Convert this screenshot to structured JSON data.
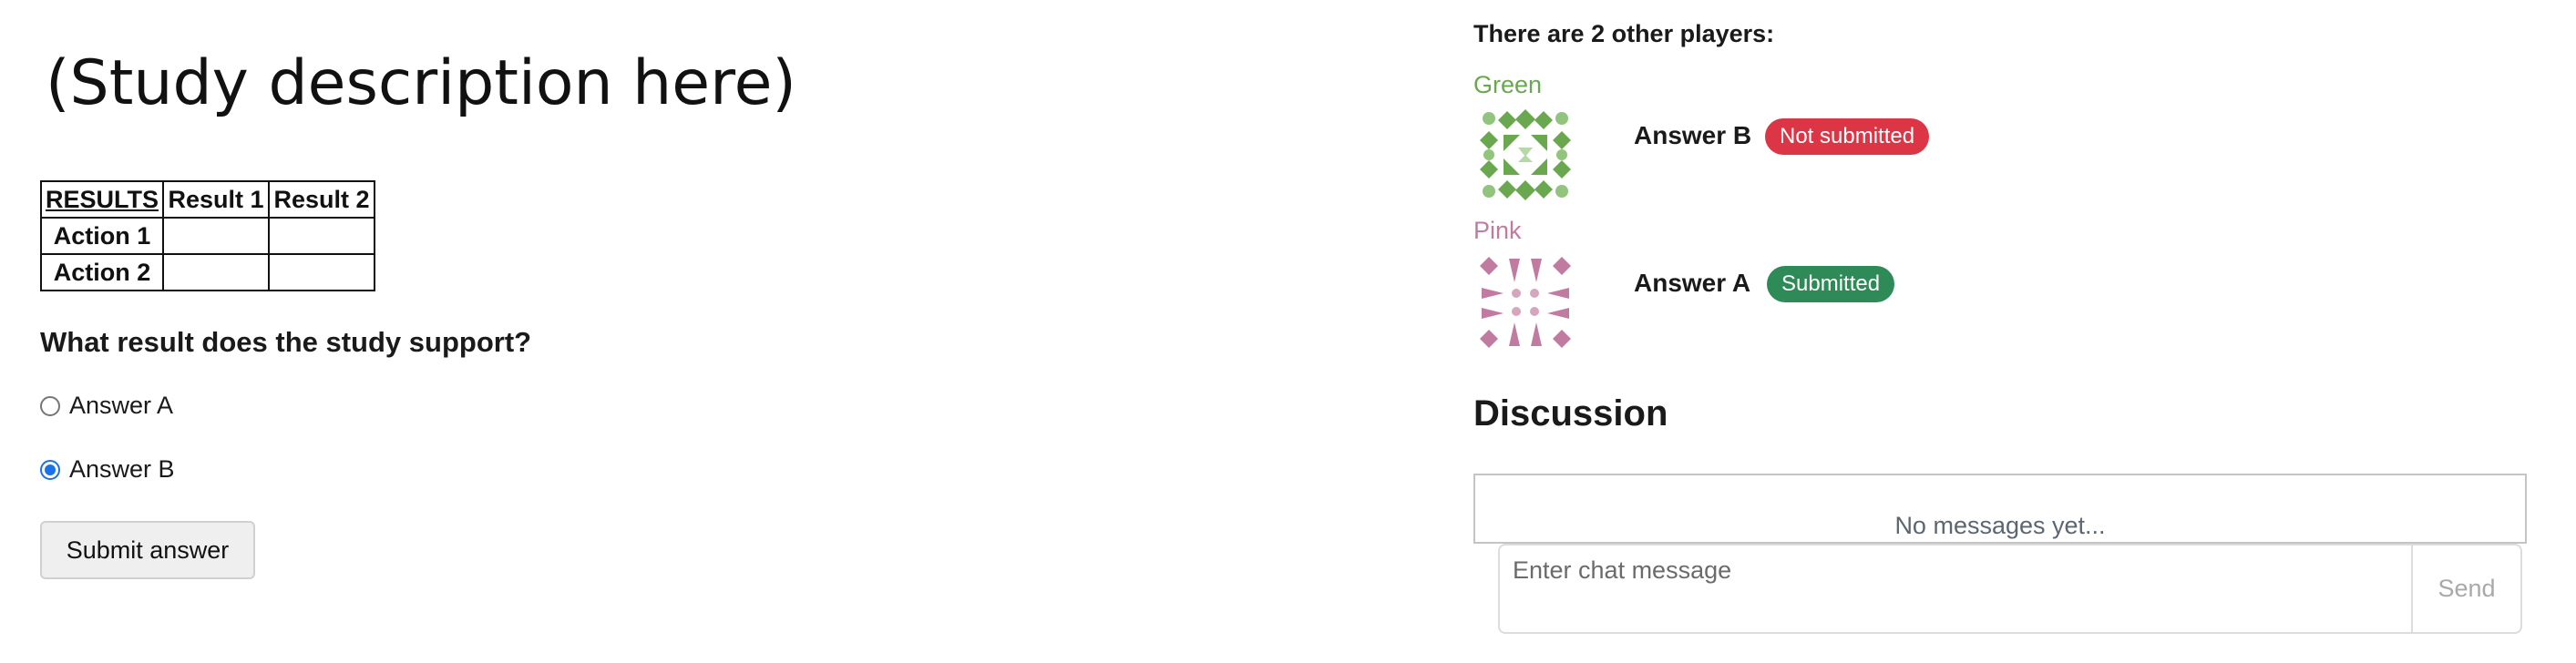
{
  "study": {
    "description": "(Study description here)",
    "table": {
      "header": [
        "RESULTS",
        "Result 1",
        "Result 2"
      ],
      "rows": [
        {
          "label": "Action 1",
          "values": [
            "",
            ""
          ]
        },
        {
          "label": "Action 2",
          "values": [
            "",
            ""
          ]
        }
      ]
    },
    "question": "What result does the study support?",
    "options": [
      {
        "label": "Answer A",
        "checked": false
      },
      {
        "label": "Answer B",
        "checked": true
      }
    ],
    "submit_label": "Submit answer"
  },
  "players": {
    "heading": "There are 2 other players:",
    "list": [
      {
        "name": "Green",
        "color": "#6aa84f",
        "answer": "Answer B",
        "status": "Not submitted",
        "status_color": "#dc3545"
      },
      {
        "name": "Pink",
        "color": "#c27ba0",
        "answer": "Answer A",
        "status": "Submitted",
        "status_color": "#2e8b57"
      }
    ]
  },
  "discussion": {
    "title": "Discussion",
    "empty_text": "No messages yet...",
    "input_placeholder": "Enter chat message",
    "send_label": "Send"
  }
}
